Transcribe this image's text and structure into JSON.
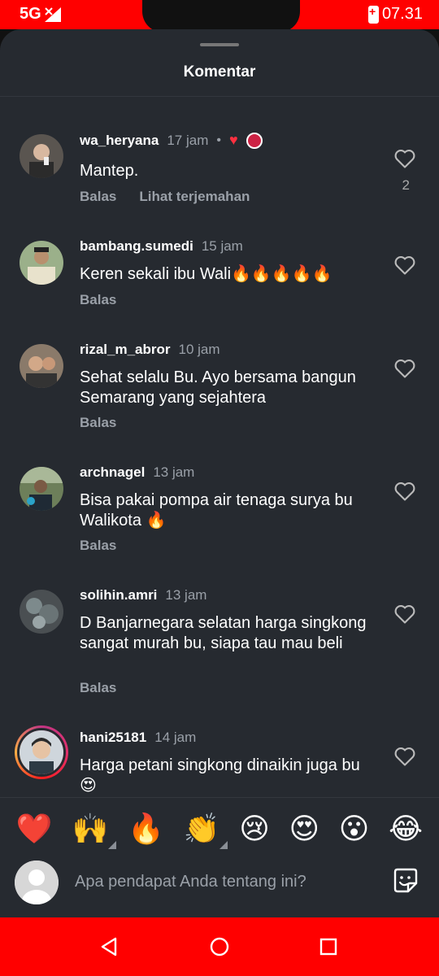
{
  "status_bar": {
    "network": "5G",
    "time": "07.31",
    "background": "#ff0000"
  },
  "sheet": {
    "title": "Komentar"
  },
  "comments": [
    {
      "username": "wa_heryana",
      "time": "17 jam",
      "text": "Mantep.",
      "actions": [
        "Balas",
        "Lihat terjemahan"
      ],
      "like_count": "2",
      "creator_liked": true
    },
    {
      "username": "bambang.sumedi",
      "time": "15 jam",
      "text": "Keren sekali ibu Wali🔥🔥🔥🔥🔥",
      "actions": [
        "Balas"
      ]
    },
    {
      "username": "rizal_m_abror",
      "time": "10 jam",
      "text": "Sehat selalu Bu. Ayo bersama bangun Semarang yang sejahtera",
      "actions": [
        "Balas"
      ]
    },
    {
      "username": "archnagel",
      "time": "13 jam",
      "text": "Bisa pakai pompa air tenaga surya bu Walikota 🔥",
      "actions": [
        "Balas"
      ]
    },
    {
      "username": "solihin.amri",
      "time": "13 jam",
      "text": "D Banjarnegara selatan harga singkong sangat murah bu, siapa tau mau beli",
      "actions": [
        "Balas"
      ]
    },
    {
      "username": "hani25181",
      "time": "14 jam",
      "text": "Harga petani singkong dinaikin juga bu😍",
      "actions": []
    }
  ],
  "emoji_bar": [
    "❤️",
    "🙌",
    "🔥",
    "👏",
    "😢",
    "😍",
    "😮",
    "😂"
  ],
  "composer": {
    "placeholder": "Apa pendapat Anda tentang ini?"
  },
  "colors": {
    "background": "#262a30",
    "accent_red": "#ff0000",
    "muted_text": "#9aa0a8",
    "like_red": "#ff3040"
  }
}
